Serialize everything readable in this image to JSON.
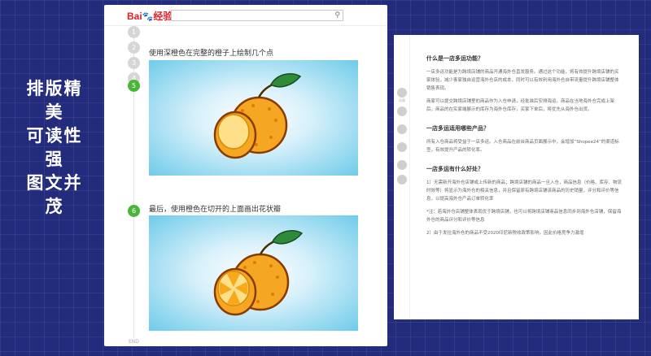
{
  "slogan": {
    "line1": "排版精美",
    "line2": "可读性强",
    "line3": "图文并茂"
  },
  "left_page": {
    "logo": {
      "bai": "Bai",
      "paw": "🐾",
      "jingyan": "经验"
    },
    "search": {
      "placeholder": "",
      "icon": "search-icon"
    },
    "steps": [
      {
        "number": "1"
      },
      {
        "number": "2"
      },
      {
        "number": "3"
      },
      {
        "number": "4"
      },
      {
        "number": "5",
        "text": "使用深橙色在完整的橙子上绘制几个点"
      },
      {
        "number": "6",
        "text": "最后，使用橙色在切开的上面画出花状瓣"
      }
    ],
    "end_label": "END",
    "colors": {
      "orange": "#f5a623",
      "dark_orange": "#e07b00",
      "leaf": "#2e8b3a",
      "active_step": "#4bb53a"
    }
  },
  "right_page": {
    "side_tools": [
      {
        "icon": "star-icon",
        "label": "收藏"
      },
      {
        "icon": "like-icon",
        "label": ""
      },
      {
        "icon": "comment-icon",
        "label": ""
      },
      {
        "icon": "share-icon",
        "label": ""
      },
      {
        "icon": "weibo-icon",
        "label": ""
      },
      {
        "icon": "qq-icon",
        "label": ""
      }
    ],
    "sections": [
      {
        "heading": "什么是一店多运功能？",
        "paragraphs": [
          "一店多运功能是为跨境店铺的商品开通海外仓直发服务。通过这个功能，将有效提升跨境店铺的买家体验，减少客家独自运营海外仓店的成本，同时可以有效利用海外仓自带流量提升跨境店铺整体销售表现。",
          "商家可以提交跨境店铺里的商品作为入仓申请，经批准后安排海运，商品在当地海外仓完成上架后，商品的在实家端展示的库存为海外仓库存，买家下单后，将优先从海外仓出货。"
        ]
      },
      {
        "heading": "一店多运适用哪些产品？",
        "paragraphs": [
          "所有入仓商品将受益于一店多运。入仓商品在前台商品页面展示中，会增加“Shopee24”的渠道标签，有效提升产品的转化率。"
        ]
      },
      {
        "heading": "一店多运有什么好处？",
        "paragraphs": [
          "1）无需新开海外仓店铺或上传新的商品；跨境店铺的商品一旦入仓，商品信息（价格、库存、物流时效等）将显示为海外仓的相关信息，并且保留原有跨境店铺该商品的历史销量，评分和评价等信息，以提高海外仓产品订单转化率",
          "*注：若海外仓店铺整体表现优于跨境店铺，也可以将跨境店铺商品信息同步到海外仓店铺，保留海外仓的商品评分和评价等信息",
          "2）由于发往海外仓的商品不受2020印尼新税收政策影响，因此价格竞争力激增"
        ]
      }
    ]
  }
}
